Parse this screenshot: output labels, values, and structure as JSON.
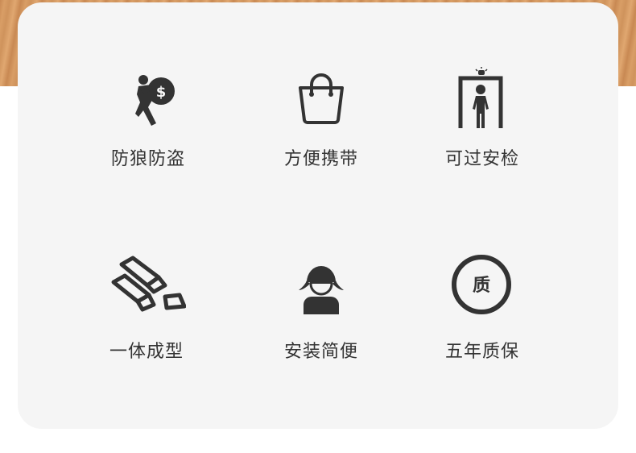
{
  "colors": {
    "icon": "#333333",
    "card": "#f5f5f5",
    "text": "#333333"
  },
  "features": [
    {
      "icon": "thief-moneybag-icon",
      "label": "防狼防盗"
    },
    {
      "icon": "shopping-bag-icon",
      "label": "方便携带"
    },
    {
      "icon": "security-gate-icon",
      "label": "可过安检"
    },
    {
      "icon": "ingots-icon",
      "label": "一体成型"
    },
    {
      "icon": "person-icon",
      "label": "安装简便"
    },
    {
      "icon": "quality-badge-icon",
      "label": "五年质保",
      "badge_text": "质"
    }
  ]
}
